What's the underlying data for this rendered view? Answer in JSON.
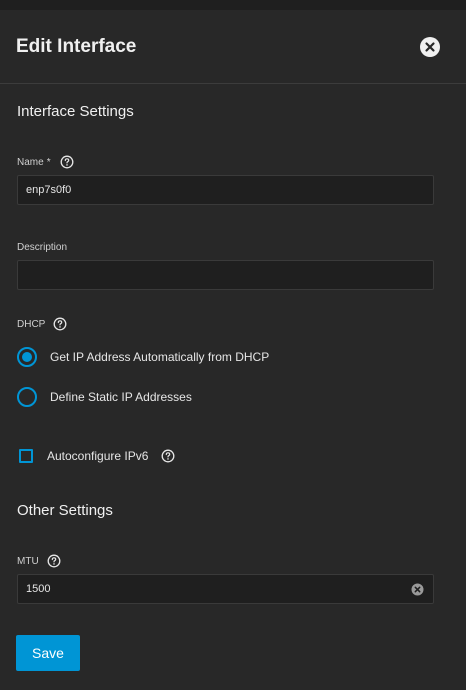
{
  "dialog": {
    "title": "Edit Interface"
  },
  "sections": {
    "interface_settings": "Interface Settings",
    "other_settings": "Other Settings"
  },
  "fields": {
    "name": {
      "label": "Name",
      "required_marker": "*",
      "value": "enp7s0f0"
    },
    "description": {
      "label": "Description",
      "value": ""
    },
    "dhcp": {
      "label": "DHCP",
      "options": [
        {
          "label": "Get IP Address Automatically from DHCP",
          "selected": true
        },
        {
          "label": "Define Static IP Addresses",
          "selected": false
        }
      ]
    },
    "autoconfigure_ipv6": {
      "label": "Autoconfigure IPv6",
      "checked": false
    },
    "mtu": {
      "label": "MTU",
      "value": "1500"
    }
  },
  "actions": {
    "save_label": "Save"
  },
  "icons": {
    "close": "close-icon",
    "help": "help-icon",
    "clear": "clear-icon"
  },
  "colors": {
    "accent": "#0095d5",
    "background": "#282828",
    "input_background": "#1f1f1f"
  }
}
